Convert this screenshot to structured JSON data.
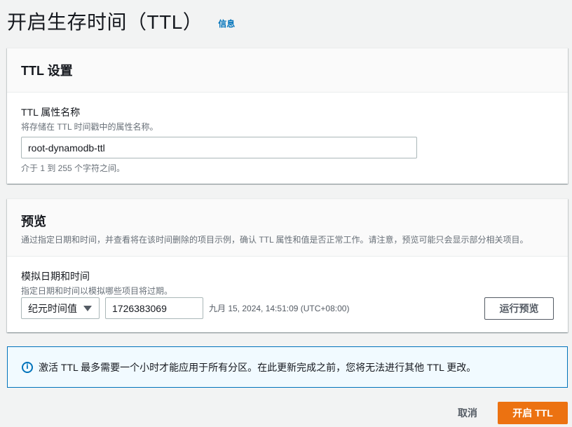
{
  "page": {
    "title": "开启生存时间（TTL）",
    "info_link": "信息"
  },
  "ttl_settings": {
    "title": "TTL 设置",
    "attribute_label": "TTL 属性名称",
    "attribute_description": "将存储在 TTL 时间戳中的属性名称。",
    "attribute_value": "root-dynamodb-ttl",
    "attribute_constraint": "介于 1 到 255 个字符之间。"
  },
  "preview": {
    "title": "预览",
    "description": "通过指定日期和时间，并查看将在该时间删除的项目示例，确认 TTL 属性和值是否正常工作。请注意，预览可能只会显示部分相关项目。",
    "sim_label": "模拟日期和时间",
    "sim_description": "指定日期和时间以模拟哪些项目将过期。",
    "select_value": "纪元时间值",
    "epoch_value": "1726383069",
    "converted_time": "九月 15, 2024, 14:51:09 (UTC+08:00)",
    "run_button": "运行预览"
  },
  "alert": {
    "icon": "info-icon",
    "text": "激活 TTL 最多需要一个小时才能应用于所有分区。在此更新完成之前，您将无法进行其他 TTL 更改。"
  },
  "footer": {
    "cancel": "取消",
    "submit": "开启 TTL"
  },
  "colors": {
    "primary": "#ec7211",
    "link": "#0073bb",
    "alert_bg": "#f1faff"
  }
}
